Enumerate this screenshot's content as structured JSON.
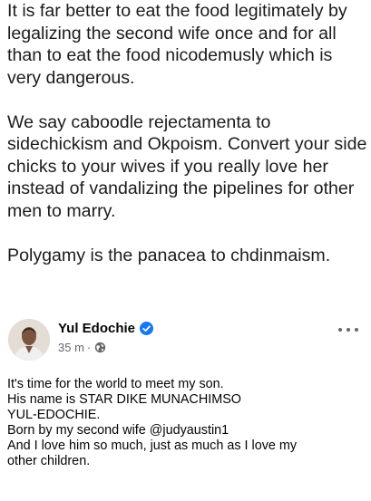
{
  "top_text": {
    "paragraph_1": "It is far better to eat the food legitimately by legalizing the second  wife once and for all  than to eat the food nicodemusly which is very dangerous.",
    "paragraph_2": "We say caboodle rejectamenta to sidechickism and Okpoism.  Convert your side chicks to your wives if you really love her  instead of vandalizing the pipelines for other men to marry.",
    "paragraph_3": "Polygamy is the panacea to chdinmaism."
  },
  "post": {
    "author": "Yul Edochie",
    "verified": true,
    "time": "35 m",
    "separator": "·",
    "audience_icon": "globe-icon",
    "more_icon": "more-dots-icon",
    "lines": [
      "It's time for the world to meet my son.",
      "His name is STAR DIKE MUNACHIMSO",
      "YUL-EDOCHIE.",
      "Born by my second wife @judyaustin1",
      "And I love him so much, just as much as I love my",
      "other children."
    ]
  },
  "colors": {
    "verified_blue": "#1877f2",
    "meta_gray": "#65676b",
    "text": "#050505"
  }
}
